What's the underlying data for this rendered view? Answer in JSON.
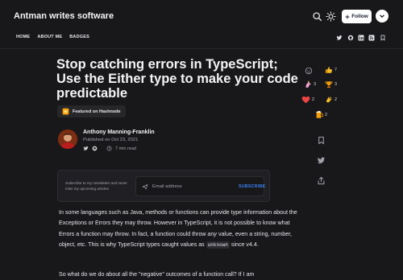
{
  "header": {
    "site_title": "Antman writes software",
    "follow_label": "Follow",
    "nav": [
      "HOME",
      "ABOUT ME",
      "BADGES"
    ]
  },
  "article": {
    "title": "Stop catching errors in TypeScript; Use the Either type to make your code predictable",
    "featured_badge": "Featured on Hashnode",
    "author_name": "Anthony Manning-Franklin",
    "published": "Published on Oct 23, 2021",
    "read_time": "7 min read",
    "para1_a": "In some languages such as Java, methods or functions can provide type information about the Exceptions or Errors they may throw. However in TypeScript, it is not possible to know what Errors a function may throw. In fact, a function could throw ",
    "para1_em": "any",
    "para1_b": " value, even a string, number, object, etc. This is why TypeScript types caught values as ",
    "para1_code": "unknown",
    "para1_c": " since v4.4.",
    "para2": "So what do we do about all the \"negative\" outcomes of a function call? If I am"
  },
  "newsletter": {
    "text": "Subscribe to my newsletter and never miss my upcoming articles",
    "placeholder": "Email address",
    "subscribe_label": "SUBSCRIBE"
  },
  "reactions": {
    "thumbs_up": "7",
    "unicorn": "3",
    "trophy": "3",
    "heart": "2",
    "clap": "2",
    "beer": "2"
  },
  "icons": [
    "search-icon",
    "sun-icon",
    "plus-icon",
    "twitter-icon",
    "github-icon",
    "linkedin-icon",
    "rss-icon",
    "calendar-icon",
    "clock-icon",
    "send-icon",
    "bookmark-icon",
    "share-icon",
    "add-reaction-icon"
  ],
  "colors": {
    "background": "#18181b",
    "accent": "#3b82f6",
    "text": "#e5e7eb",
    "muted": "#a1a1aa"
  }
}
